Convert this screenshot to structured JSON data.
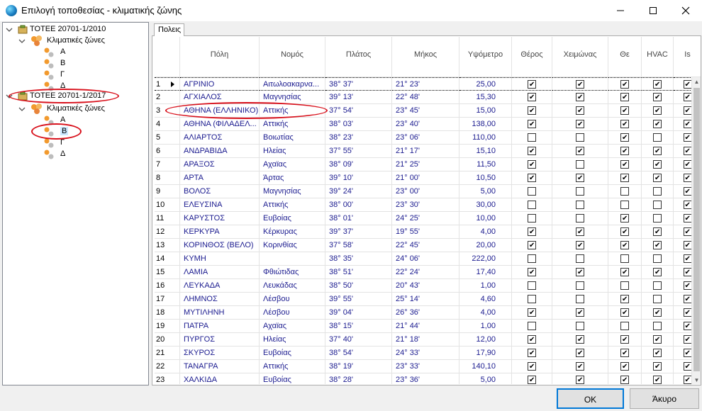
{
  "window": {
    "title": "Επιλογή τοποθεσίας - κλιματικής ζώνης"
  },
  "tree": {
    "root1": {
      "label": "ΤΟΤΕΕ 20701-1/2010",
      "zones_label": "Κλιματικές ζώνες",
      "zones": [
        "Α",
        "Β",
        "Γ",
        "Δ"
      ]
    },
    "root2": {
      "label": "ΤΟΤΕΕ 20701-1/2017",
      "zones_label": "Κλιματικές ζώνες",
      "zones": [
        "Α",
        "Β",
        "Γ",
        "Δ"
      ],
      "selected_zone": "Β"
    }
  },
  "tab": {
    "label": "Πολεις"
  },
  "table": {
    "columns": [
      "Πόλη",
      "Νομός",
      "Πλάτος",
      "Μήκος",
      "Υψόμετρο",
      "Θέρος",
      "Χειμώνας",
      "Θε",
      "HVAC",
      "Is"
    ],
    "rows": [
      {
        "n": "1",
        "city": "ΑΓΡΙΝΙΟ",
        "pref": "Αιτωλοακαρνα...",
        "lat": "38°  37'",
        "lon": "21°  23'",
        "alt": "25,00",
        "c": [
          true,
          true,
          true,
          true,
          true
        ]
      },
      {
        "n": "2",
        "city": "ΑΓΧΙΑΛΟΣ",
        "pref": "Μαγνησίας",
        "lat": "39°  13'",
        "lon": "22°  48'",
        "alt": "15,30",
        "c": [
          true,
          true,
          true,
          true,
          true
        ]
      },
      {
        "n": "3",
        "city": "ΑΘΗΝΑ (ΕΛΛΗΝΙΚΟ)",
        "pref": "Αττικής",
        "lat": "37°  54'",
        "lon": "23°  45'",
        "alt": "15,00",
        "c": [
          true,
          true,
          true,
          true,
          true
        ]
      },
      {
        "n": "4",
        "city": "ΑΘΗΝΑ (ΦΙΛΑΔΕΛ...",
        "pref": "Αττικής",
        "lat": "38°  03'",
        "lon": "23°  40'",
        "alt": "138,00",
        "c": [
          true,
          true,
          true,
          true,
          true
        ]
      },
      {
        "n": "5",
        "city": "ΑΛΙΑΡΤΟΣ",
        "pref": "Βοιωτίας",
        "lat": "38°  23'",
        "lon": "23°  06'",
        "alt": "110,00",
        "c": [
          false,
          false,
          true,
          false,
          true
        ]
      },
      {
        "n": "6",
        "city": "ΑΝΔΡΑΒΙΔΑ",
        "pref": "Ηλείας",
        "lat": "37°  55'",
        "lon": "21°  17'",
        "alt": "15,10",
        "c": [
          true,
          true,
          true,
          true,
          true
        ]
      },
      {
        "n": "7",
        "city": "ΑΡΑΞΟΣ",
        "pref": "Αχαϊας",
        "lat": "38°  09'",
        "lon": "21°  25'",
        "alt": "11,50",
        "c": [
          true,
          false,
          true,
          true,
          true
        ]
      },
      {
        "n": "8",
        "city": "ΑΡΤΑ",
        "pref": "Άρτας",
        "lat": "39°  10'",
        "lon": "21°  00'",
        "alt": "10,50",
        "c": [
          true,
          true,
          true,
          true,
          true
        ]
      },
      {
        "n": "9",
        "city": "ΒΟΛΟΣ",
        "pref": "Μαγνησίας",
        "lat": "39°  24'",
        "lon": "23°  00'",
        "alt": "5,00",
        "c": [
          false,
          false,
          false,
          false,
          true
        ]
      },
      {
        "n": "10",
        "city": "ΕΛΕΥΣΙΝΑ",
        "pref": "Αττικής",
        "lat": "38°  00'",
        "lon": "23°  30'",
        "alt": "30,00",
        "c": [
          false,
          false,
          false,
          false,
          true
        ]
      },
      {
        "n": "11",
        "city": "ΚΑΡΥΣΤΟΣ",
        "pref": "Ευβοίας",
        "lat": "38°  01'",
        "lon": "24°  25'",
        "alt": "10,00",
        "c": [
          false,
          false,
          true,
          false,
          true
        ]
      },
      {
        "n": "12",
        "city": "ΚΕΡΚΥΡΑ",
        "pref": "Κέρκυρας",
        "lat": "39°  37'",
        "lon": "19°  55'",
        "alt": "4,00",
        "c": [
          true,
          true,
          true,
          true,
          true
        ]
      },
      {
        "n": "13",
        "city": "ΚΟΡΙΝΘΟΣ (ΒΕΛΟ)",
        "pref": "Κορινθίας",
        "lat": "37°  58'",
        "lon": "22°  45'",
        "alt": "20,00",
        "c": [
          true,
          true,
          true,
          true,
          true
        ]
      },
      {
        "n": "14",
        "city": "ΚΥΜΗ",
        "pref": "",
        "lat": "38°  35'",
        "lon": "24°  06'",
        "alt": "222,00",
        "c": [
          false,
          false,
          false,
          false,
          true
        ]
      },
      {
        "n": "15",
        "city": "ΛΑΜΙΑ",
        "pref": "Φθιώτιδας",
        "lat": "38°  51'",
        "lon": "22°  24'",
        "alt": "17,40",
        "c": [
          true,
          true,
          true,
          true,
          true
        ]
      },
      {
        "n": "16",
        "city": "ΛΕΥΚΑΔΑ",
        "pref": "Λευκάδας",
        "lat": "38°  50'",
        "lon": "20°  43'",
        "alt": "1,00",
        "c": [
          false,
          false,
          false,
          false,
          true
        ]
      },
      {
        "n": "17",
        "city": "ΛΗΜΝΟΣ",
        "pref": "Λέσβου",
        "lat": "39°  55'",
        "lon": "25°  14'",
        "alt": "4,60",
        "c": [
          false,
          false,
          true,
          false,
          true
        ]
      },
      {
        "n": "18",
        "city": "ΜΥΤΙΛΗΝΗ",
        "pref": "Λέσβου",
        "lat": "39°  04'",
        "lon": "26°  36'",
        "alt": "4,00",
        "c": [
          true,
          true,
          true,
          true,
          true
        ]
      },
      {
        "n": "19",
        "city": "ΠΑΤΡΑ",
        "pref": "Αχαϊας",
        "lat": "38°  15'",
        "lon": "21°  44'",
        "alt": "1,00",
        "c": [
          false,
          false,
          false,
          false,
          true
        ]
      },
      {
        "n": "20",
        "city": "ΠΥΡΓΟΣ",
        "pref": "Ηλείας",
        "lat": "37°  40'",
        "lon": "21°  18'",
        "alt": "12,00",
        "c": [
          true,
          true,
          true,
          true,
          true
        ]
      },
      {
        "n": "21",
        "city": "ΣΚΥΡΟΣ",
        "pref": "Ευβοίας",
        "lat": "38°  54'",
        "lon": "24°  33'",
        "alt": "17,90",
        "c": [
          true,
          true,
          true,
          true,
          true
        ]
      },
      {
        "n": "22",
        "city": "ΤΑΝΑΓΡΑ",
        "pref": "Αττικής",
        "lat": "38°  19'",
        "lon": "23°  33'",
        "alt": "140,10",
        "c": [
          true,
          true,
          true,
          true,
          true
        ]
      },
      {
        "n": "23",
        "city": "ΧΑΛΚΙΔΑ",
        "pref": "Ευβοίας",
        "lat": "38°  28'",
        "lon": "23°  36'",
        "alt": "5,00",
        "c": [
          true,
          true,
          true,
          true,
          true
        ]
      }
    ]
  },
  "buttons": {
    "ok": "OK",
    "cancel": "Άκυρο"
  },
  "colors": {
    "annotation": "#d8101b",
    "link_text": "#1b1b8f",
    "accent": "#0078d7"
  }
}
